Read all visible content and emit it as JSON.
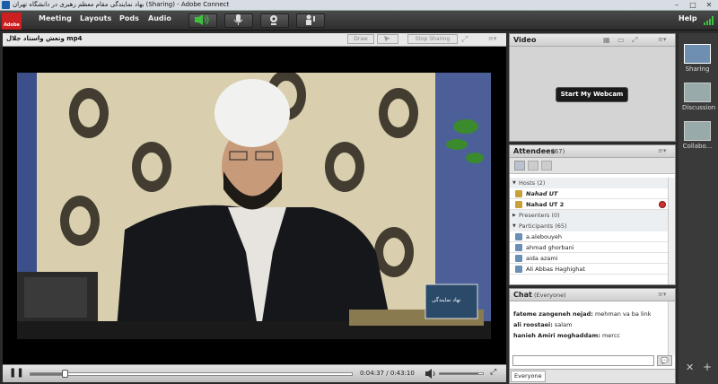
{
  "window": {
    "title": "بهاد نمایندگی مقام معظم رهبری در دانشگاه تهران (Sharing) - Adobe Connect"
  },
  "menu": {
    "logo_text": "Adobe",
    "items": [
      "Meeting",
      "Layouts",
      "Pods",
      "Audio"
    ],
    "help": "Help"
  },
  "share_pod": {
    "filename": "وتعش واستاد جلال mp4",
    "draw_label": "Draw",
    "stop_sharing_label": "Stop Sharing",
    "time_current": "0:04:37",
    "time_sep": "/",
    "time_total": "0:43:10",
    "progress": 0.107,
    "volume": 0.9,
    "watermark": "نهاد نمایندگی"
  },
  "video_pod": {
    "title": "Video",
    "webcam_button": "Start My Webcam"
  },
  "attendees": {
    "title": "Attendees",
    "count": "(67)",
    "hosts_label": "Hosts (2)",
    "hosts": [
      "Nahad UT",
      "Nahad UT 2"
    ],
    "presenters_label": "Presenters (0)",
    "participants_label": "Participants (65)",
    "participants": [
      "a.alebouyeh",
      "ahmad ghorbani",
      "aida azami",
      "Ali Abbas Haghighat"
    ]
  },
  "chat": {
    "title": "Chat",
    "scope": "(Everyone)",
    "messages": [
      {
        "name": "fateme zangeneh nejad:",
        "text": "mehman va ba link"
      },
      {
        "name": "ali roostaei:",
        "text": "salam"
      },
      {
        "name": "hanieh Amiri moghaddam:",
        "text": "mercc"
      }
    ],
    "tab": "Everyone"
  },
  "layouts": [
    "Sharing",
    "Discussion",
    "Collabo..."
  ],
  "colors": {
    "menubar": "#3a3a3a",
    "accent_green": "#3fbf3f",
    "pod_bg": "#d4d4d4"
  }
}
